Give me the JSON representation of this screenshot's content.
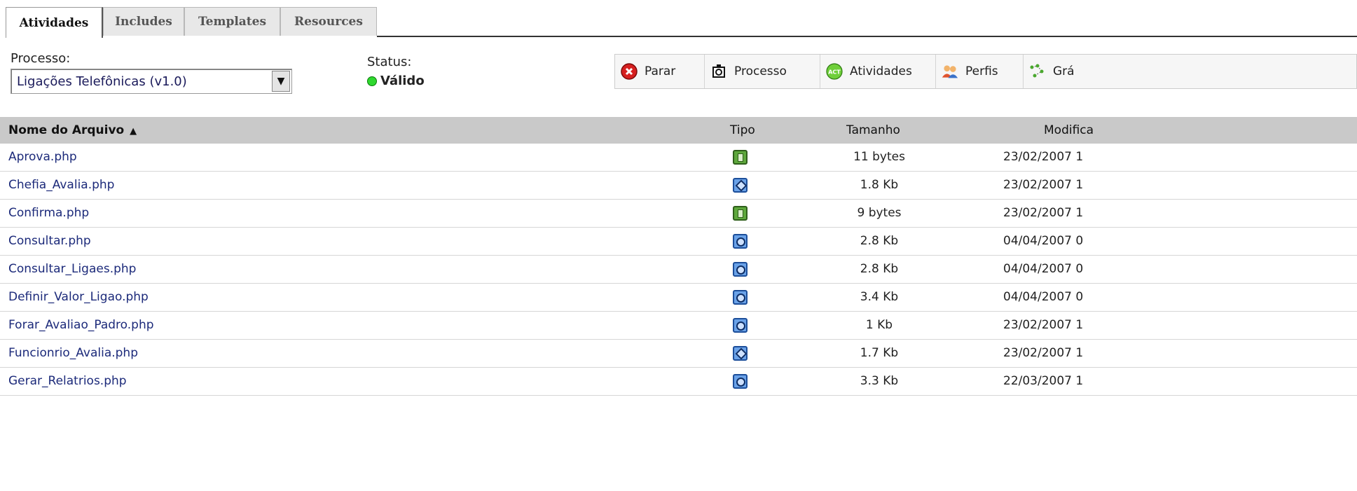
{
  "tabs": [
    {
      "label": "Atividades",
      "active": true
    },
    {
      "label": "Includes",
      "active": false
    },
    {
      "label": "Templates",
      "active": false
    },
    {
      "label": "Resources",
      "active": false
    }
  ],
  "process": {
    "label": "Processo:",
    "selected": "Ligações Telefônicas (v1.0)"
  },
  "status": {
    "label": "Status:",
    "value": "Válido",
    "color": "#2fd82f"
  },
  "toolbar": {
    "stop": "Parar",
    "process": "Processo",
    "activities": "Atividades",
    "activities_icon_text": "ACT",
    "profiles": "Perfis",
    "graph": "Grá"
  },
  "table": {
    "headers": {
      "name": "Nome do Arquivo",
      "sort_icon": "▲",
      "type": "Tipo",
      "size": "Tamanho",
      "modified": "Modifica"
    },
    "rows": [
      {
        "name": "Aprova.php",
        "type": "green-square",
        "size": "11 bytes",
        "modified": "23/02/2007 1"
      },
      {
        "name": "Chefia_Avalia.php",
        "type": "blue-diamond",
        "size": "1.8 Kb",
        "modified": "23/02/2007 1"
      },
      {
        "name": "Confirma.php",
        "type": "green-square",
        "size": "9 bytes",
        "modified": "23/02/2007 1"
      },
      {
        "name": "Consultar.php",
        "type": "blue-circle",
        "size": "2.8 Kb",
        "modified": "04/04/2007 0"
      },
      {
        "name": "Consultar_Ligaes.php",
        "type": "blue-circle",
        "size": "2.8 Kb",
        "modified": "04/04/2007 0"
      },
      {
        "name": "Definir_Valor_Ligao.php",
        "type": "blue-circle",
        "size": "3.4 Kb",
        "modified": "04/04/2007 0"
      },
      {
        "name": "Forar_Avaliao_Padro.php",
        "type": "blue-circle",
        "size": "1 Kb",
        "modified": "23/02/2007 1"
      },
      {
        "name": "Funcionrio_Avalia.php",
        "type": "blue-diamond",
        "size": "1.7 Kb",
        "modified": "23/02/2007 1"
      },
      {
        "name": "Gerar_Relatrios.php",
        "type": "blue-circle",
        "size": "3.3 Kb",
        "modified": "22/03/2007 1"
      }
    ]
  }
}
